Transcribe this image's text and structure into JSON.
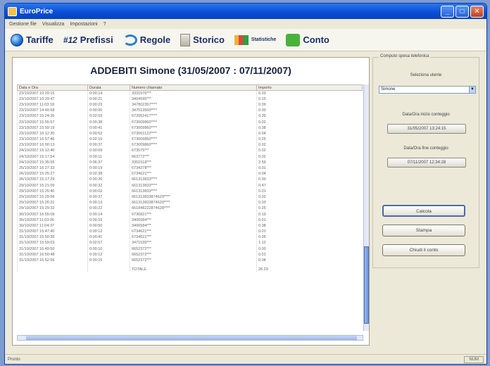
{
  "window": {
    "title": "EuroPrice"
  },
  "menu": [
    "Gestione file",
    "Visualizza",
    "Impostazioni",
    "?"
  ],
  "toolbar": {
    "tariffe": "Tariffe",
    "prefissi": "Prefissi",
    "prefissi_prefix": "#12",
    "regole": "Regole",
    "storico": "Storico",
    "statistiche": "Statistiche",
    "conto": "Conto"
  },
  "report": {
    "title": "ADDEBITI Simone (31/05/2007 : 07/11/2007)",
    "columns": [
      "Data e Ora",
      "Durata",
      "Numero chiamato",
      "Importo"
    ],
    "rows": [
      [
        "23/10/2007 10:29:15",
        "0:00:14",
        "3331576***",
        "0.03"
      ],
      [
        "23/10/2007 10:29:47",
        "0:00:21",
        "3404595***",
        "0.15"
      ],
      [
        "23/10/2007 11:03:18",
        "0:00:23",
        "347802357****",
        "0.09"
      ],
      [
        "23/10/2007 14:40:58",
        "0:00:00",
        "347513500****",
        "0.00"
      ],
      [
        "23/10/2007 15:24:35",
        "0:02:03",
        "672052417****",
        "0.39"
      ],
      [
        "23/10/2007 15:55:57",
        "0:00:38",
        "673009860****",
        "0.02"
      ],
      [
        "23/10/2007 15:59:19",
        "0:00:41",
        "673009860****",
        "0.08"
      ],
      [
        "23/10/2007 16:12:30",
        "0:00:52",
        "673061122****",
        "0.04"
      ],
      [
        "23/10/2007 16:57:46",
        "0:02:16",
        "673009860****",
        "0.25"
      ],
      [
        "23/10/2007 16:00:13",
        "0:00:37",
        "673009860****",
        "0.02"
      ],
      [
        "24/10/2007 15:12:40",
        "0:00:09",
        "673575***",
        "0.02"
      ],
      [
        "24/10/2007 15:17:54",
        "0:00:11",
        "663772***",
        "0.02"
      ],
      [
        "24/10/2007 15:35:55",
        "0:06:37",
        "3351518***",
        "2.59"
      ],
      [
        "25/10/2007 16:27:33",
        "0:00:19",
        "6734278***",
        "0.01"
      ],
      [
        "26/10/2007 15:25:27",
        "0:02:38",
        "6734621***",
        "0.04"
      ],
      [
        "26/10/2007 15:17:29",
        "0:00:26",
        "661313833****",
        "0.00"
      ],
      [
        "29/10/2007 15:21:09",
        "0:00:32",
        "661313833****",
        "0.47"
      ],
      [
        "29/10/2007 15:25:40",
        "0:00:02",
        "661313833****",
        "0.01"
      ],
      [
        "29/10/2007 15:29:56",
        "0:00:37",
        "661313833874629****",
        "0.02"
      ],
      [
        "29/10/2007 15:26:31",
        "0:00:13",
        "661313833874629****",
        "0.03"
      ],
      [
        "29/10/2007 15:29:32",
        "0:00:22",
        "661848222874628****",
        "0.25"
      ],
      [
        "30/10/2007 16:55:09",
        "0:00:14",
        "6736821***",
        "0.19"
      ],
      [
        "30/10/2007 11:03:06",
        "0:00:15",
        "3406584***",
        "0.01"
      ],
      [
        "30/10/2007 11:04:37",
        "0:00:50",
        "3406584***",
        "0.38"
      ],
      [
        "31/10/2007 15:47:40",
        "0:00:12",
        "6734621***",
        "0.01"
      ],
      [
        "31/10/2007 15:50:35",
        "0:00:41",
        "6734621***",
        "0.05"
      ],
      [
        "31/10/2007 15:59:03",
        "0:02:57",
        "3471539***",
        "1.12"
      ],
      [
        "31/10/2007 16:49:50",
        "0:00:10",
        "6652372***",
        "0.00"
      ],
      [
        "31/10/2007 16:50:48",
        "0:00:12",
        "6652372***",
        "0.01"
      ],
      [
        "31/10/2007 16:52:56",
        "0:00:15",
        "6652372***",
        "0.04"
      ]
    ],
    "total_label": "TOTALE",
    "total_value": "26.29"
  },
  "sidebar": {
    "group_label": "Computo spesa telefonica",
    "select_label": "Seleziona utente",
    "select_value": "Simone",
    "start_label": "Data/Ora inizio conteggio",
    "start_value": "31/05/2007 13:24:15",
    "end_label": "Data/Ora fine conteggio",
    "end_value": "07/11/2007 12:34:28"
  },
  "buttons": {
    "calcola": "Calcola",
    "stampa": "Stampa",
    "chiudi": "Chiudi il conto"
  },
  "status": {
    "left": "Pronto",
    "right": "NUM"
  }
}
